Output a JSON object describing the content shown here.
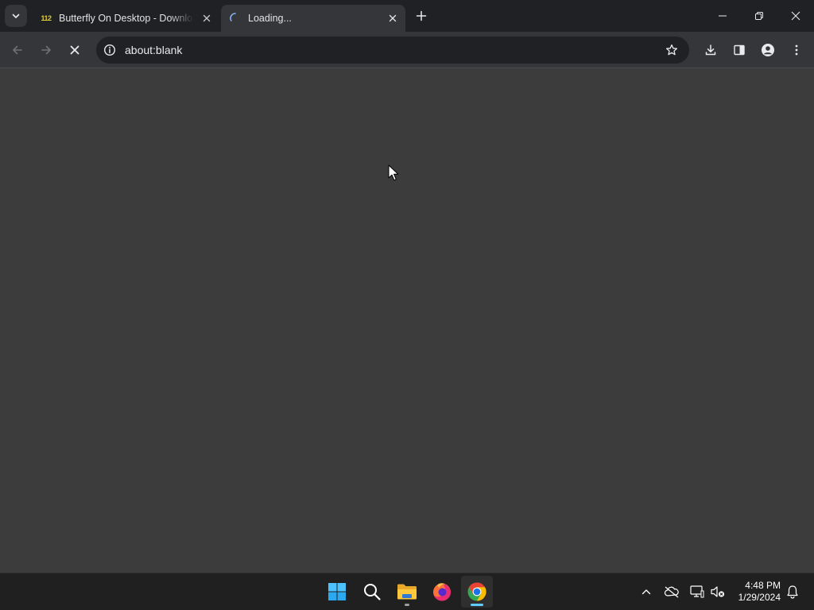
{
  "browser": {
    "tabs": [
      {
        "title": "Butterfly On Desktop - Download",
        "favicon": "112",
        "state": "inactive"
      },
      {
        "title": "Loading...",
        "state": "active-loading"
      }
    ],
    "omnibox": {
      "url": "about:blank"
    }
  },
  "taskbar": {
    "apps": [
      {
        "name": "Start",
        "icon": "windows-logo-icon"
      },
      {
        "name": "Search",
        "icon": "search-icon"
      },
      {
        "name": "File Explorer",
        "icon": "folder-icon",
        "running": true
      },
      {
        "name": "Firefox",
        "icon": "firefox-icon"
      },
      {
        "name": "Google Chrome",
        "icon": "chrome-icon",
        "running": true,
        "active": true
      }
    ],
    "clock": {
      "time": "4:48 PM",
      "date": "1/29/2024"
    }
  },
  "colors": {
    "tab_strip": "#202124",
    "toolbar": "#35363a",
    "page_background": "#3c3c3c",
    "taskbar": "#202020",
    "accent": "#60cdff"
  }
}
